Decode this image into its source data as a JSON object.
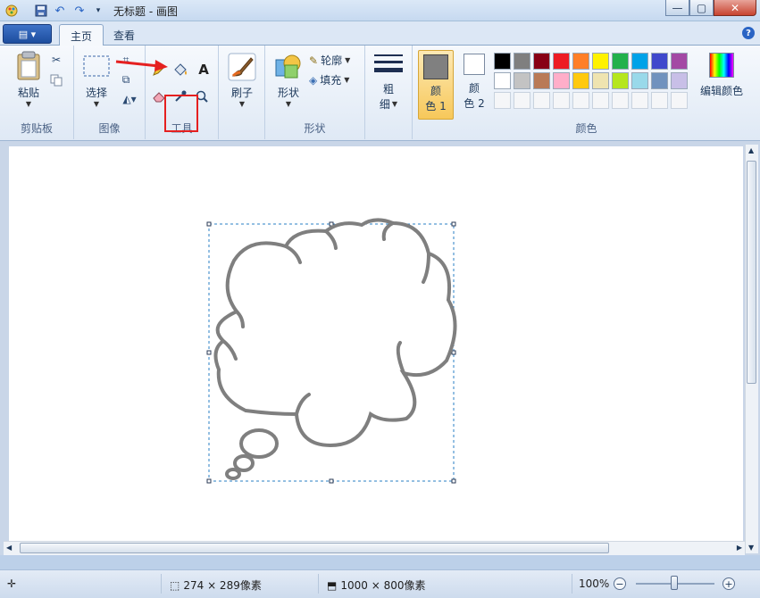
{
  "window": {
    "title": "无标题 - 画图"
  },
  "tabs": [
    {
      "label": "主页",
      "active": true
    },
    {
      "label": "查看",
      "active": false
    }
  ],
  "ribbon": {
    "clipboard": {
      "label": "剪贴板",
      "paste_label": "粘贴"
    },
    "image": {
      "label": "图像",
      "select_label": "选择"
    },
    "tools": {
      "label": "工具",
      "text_glyph": "A"
    },
    "brushes": {
      "label": "刷子"
    },
    "shapes": {
      "label": "形状",
      "shapes_label": "形状",
      "outline_label": "轮廓",
      "fill_label": "填充"
    },
    "size": {
      "label_line1": "粗",
      "label_line2": "细"
    },
    "colors": {
      "label": "颜色",
      "color1_line1": "颜",
      "color1_line2": "色 1",
      "color2_line1": "颜",
      "color2_line2": "色 2",
      "edit_label": "编辑颜色",
      "color1_value": "#808080",
      "color2_value": "#ffffff",
      "row1": [
        "#000000",
        "#7f7f7f",
        "#880015",
        "#ed1c24",
        "#ff7f27",
        "#fff200",
        "#22b14c",
        "#00a2e8",
        "#3f48cc",
        "#a349a4"
      ],
      "row2": [
        "#ffffff",
        "#c3c3c3",
        "#b97a57",
        "#ffaec9",
        "#ffc90e",
        "#efe4b0",
        "#b5e61d",
        "#99d9ea",
        "#7092be",
        "#c8bfe7"
      ]
    }
  },
  "status": {
    "selection_size": "274 × 289像素",
    "canvas_size": "1000 × 800像素",
    "zoom": "100%"
  }
}
